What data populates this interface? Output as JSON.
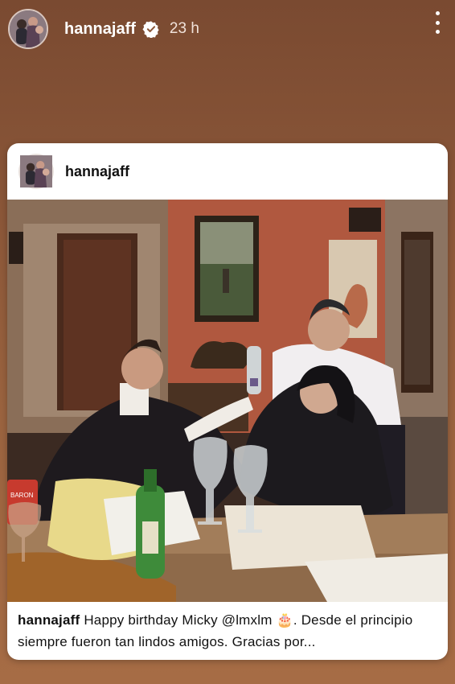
{
  "story": {
    "username": "hannajaff",
    "time": "23 h",
    "verified": true,
    "more_icon": "more-vertical-icon"
  },
  "post": {
    "username": "hannajaff",
    "caption_user": "hannajaff",
    "caption_text": "Happy birthday Micky @lmxlm 🎂. Desde el principio siempre fueron tan lindos amigos. Gracias por...",
    "can_label": "BARON"
  },
  "colors": {
    "background_top": "#7a4a31",
    "background_bottom": "#a66c45",
    "card": "#ffffff",
    "verified": "#ffffff"
  }
}
